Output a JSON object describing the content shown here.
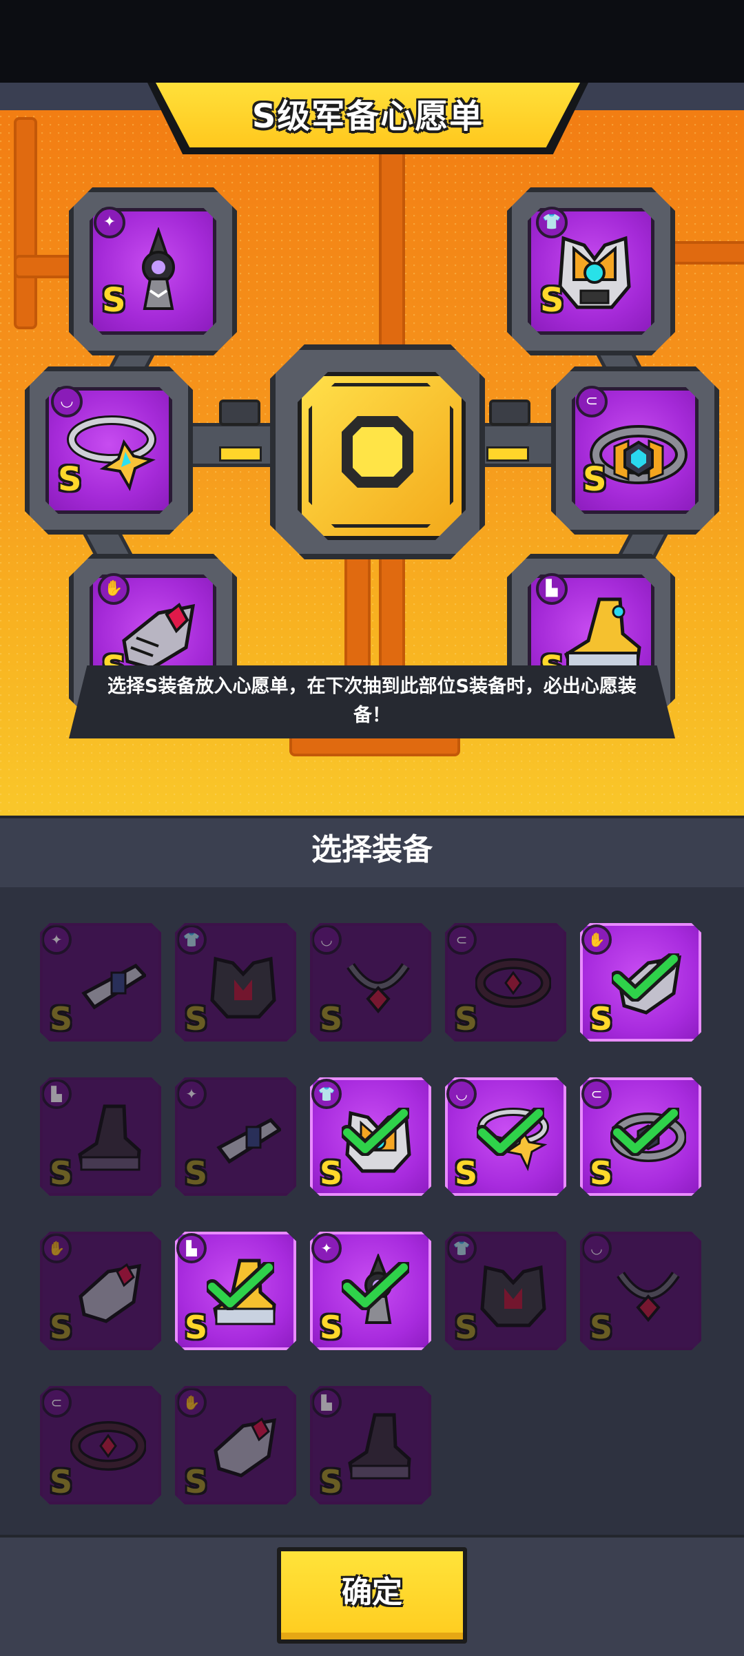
{
  "wishlist": {
    "title": "S级军备心愿单",
    "hint": "选择S装备放入心愿单，在下次抽到此部位S装备时，必出心愿装备！",
    "slots": [
      {
        "category": "weapon",
        "icon": "dagger-icon",
        "rank": "S"
      },
      {
        "category": "armor",
        "icon": "shirt-icon",
        "rank": "S"
      },
      {
        "category": "necklace",
        "icon": "necklace-icon",
        "rank": "S"
      },
      {
        "category": "belt",
        "icon": "belt-icon",
        "rank": "S"
      },
      {
        "category": "gloves",
        "icon": "glove-icon",
        "rank": "S"
      },
      {
        "category": "boots",
        "icon": "boot-icon",
        "rank": "S"
      }
    ]
  },
  "select": {
    "title": "选择装备",
    "items": [
      {
        "category": "weapon",
        "rank": "S",
        "selected": false
      },
      {
        "category": "armor",
        "rank": "S",
        "selected": false
      },
      {
        "category": "necklace",
        "rank": "S",
        "selected": false
      },
      {
        "category": "belt",
        "rank": "S",
        "selected": false
      },
      {
        "category": "gloves",
        "rank": "S",
        "selected": true
      },
      {
        "category": "boots",
        "rank": "S",
        "selected": false
      },
      {
        "category": "weapon",
        "rank": "S",
        "selected": false
      },
      {
        "category": "armor",
        "rank": "S",
        "selected": true
      },
      {
        "category": "necklace",
        "rank": "S",
        "selected": true
      },
      {
        "category": "belt",
        "rank": "S",
        "selected": true
      },
      {
        "category": "gloves",
        "rank": "S",
        "selected": false
      },
      {
        "category": "boots",
        "rank": "S",
        "selected": true
      },
      {
        "category": "weapon",
        "rank": "S",
        "selected": true
      },
      {
        "category": "armor",
        "rank": "S",
        "selected": false
      },
      {
        "category": "necklace",
        "rank": "S",
        "selected": false
      },
      {
        "category": "belt",
        "rank": "S",
        "selected": false
      },
      {
        "category": "gloves",
        "rank": "S",
        "selected": false
      },
      {
        "category": "boots",
        "rank": "S",
        "selected": false
      }
    ]
  },
  "confirm_label": "确定",
  "colors": {
    "accent_yellow": "#ffd52a",
    "panel_orange": "#f6951c",
    "slot_purple": "#a52ad8",
    "check_green": "#2fd24a",
    "background": "#2e3240"
  }
}
